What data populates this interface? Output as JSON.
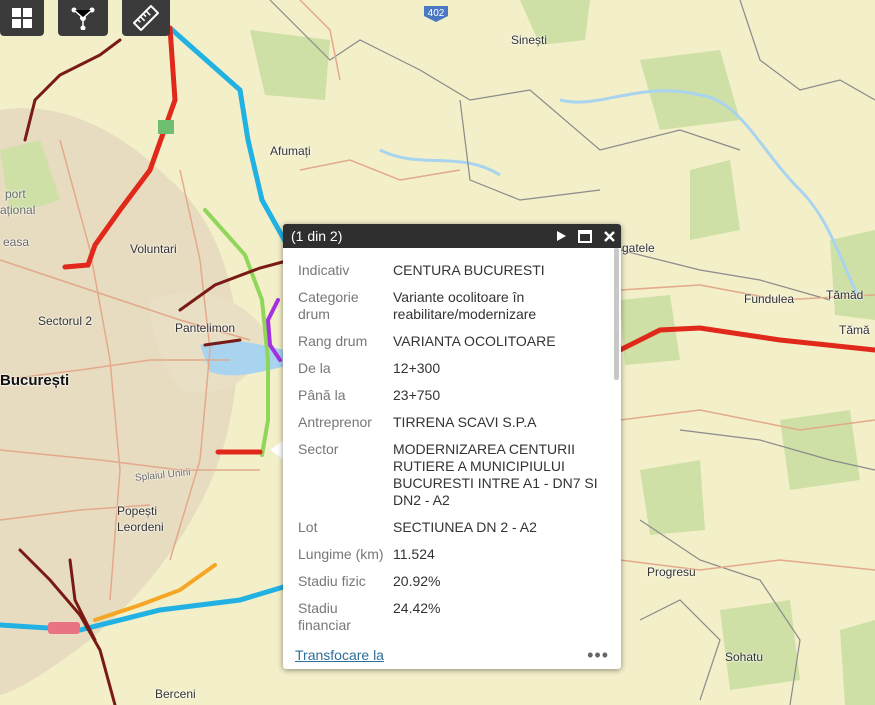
{
  "map": {
    "places": [
      {
        "id": "sinesti",
        "name": "Sinești"
      },
      {
        "id": "afumati",
        "name": "Afumați"
      },
      {
        "id": "voluntari",
        "name": "Voluntari"
      },
      {
        "id": "pantelimon",
        "name": "Pantelimon"
      },
      {
        "id": "sectorul2",
        "name": "Sectorul 2"
      },
      {
        "id": "bucuresti",
        "name": "București"
      },
      {
        "id": "popesti",
        "name": "Popești"
      },
      {
        "id": "leordeni",
        "name": "Leordeni"
      },
      {
        "id": "berceni",
        "name": "Berceni"
      },
      {
        "id": "fundulea",
        "name": "Fundulea"
      },
      {
        "id": "tamada1",
        "name": "Tămăd"
      },
      {
        "id": "tamada2",
        "name": "Tămă"
      },
      {
        "id": "progresu",
        "name": "Progresu"
      },
      {
        "id": "sohatu",
        "name": "Sohatu"
      },
      {
        "id": "gatele",
        "name": "gatele"
      },
      {
        "id": "aeroport1",
        "name": "port"
      },
      {
        "id": "aeroport2",
        "name": "ațional"
      },
      {
        "id": "aeroport3",
        "name": "easa"
      },
      {
        "id": "splaiul",
        "name": "Splaiul Unirii"
      }
    ],
    "road_shield": "402"
  },
  "toolbar": {
    "tools": [
      {
        "icon": "grid-icon"
      },
      {
        "icon": "share-network-icon"
      },
      {
        "icon": "ruler-icon"
      }
    ]
  },
  "popup": {
    "header": "(1 din 2)",
    "fields": [
      {
        "label": "Indicativ",
        "value": "CENTURA BUCURESTI"
      },
      {
        "label": "Categorie drum",
        "value": "Variante ocolitoare în reabilitare/modernizare"
      },
      {
        "label": "Rang drum",
        "value": "VARIANTA OCOLITOARE"
      },
      {
        "label": "De la",
        "value": "12+300"
      },
      {
        "label": "Până la",
        "value": "23+750"
      },
      {
        "label": "Antreprenor",
        "value": "TIRRENA SCAVI S.P.A"
      },
      {
        "label": "Sector",
        "value": "MODERNIZAREA CENTURII RUTIERE A MUNICIPIULUI BUCURESTI INTRE A1 - DN7 SI DN2 - A2"
      },
      {
        "label": "Lot",
        "value": "SECTIUNEA DN 2 - A2"
      },
      {
        "label": "Lungime (km)",
        "value": "11.524"
      },
      {
        "label": "Stadiu fizic",
        "value": "20.92%"
      },
      {
        "label": "Stadiu financiar",
        "value": "24.42%"
      }
    ],
    "zoom_link": "Transfocare la",
    "more": "•••"
  },
  "colors": {
    "road_red": "#e0281b",
    "road_blue": "#22b1e3",
    "road_dark": "#7a1a14",
    "road_purple": "#a431e0",
    "road_orange": "#f5a623",
    "water": "#a9d4ef",
    "urban": "#e7dcc0"
  }
}
